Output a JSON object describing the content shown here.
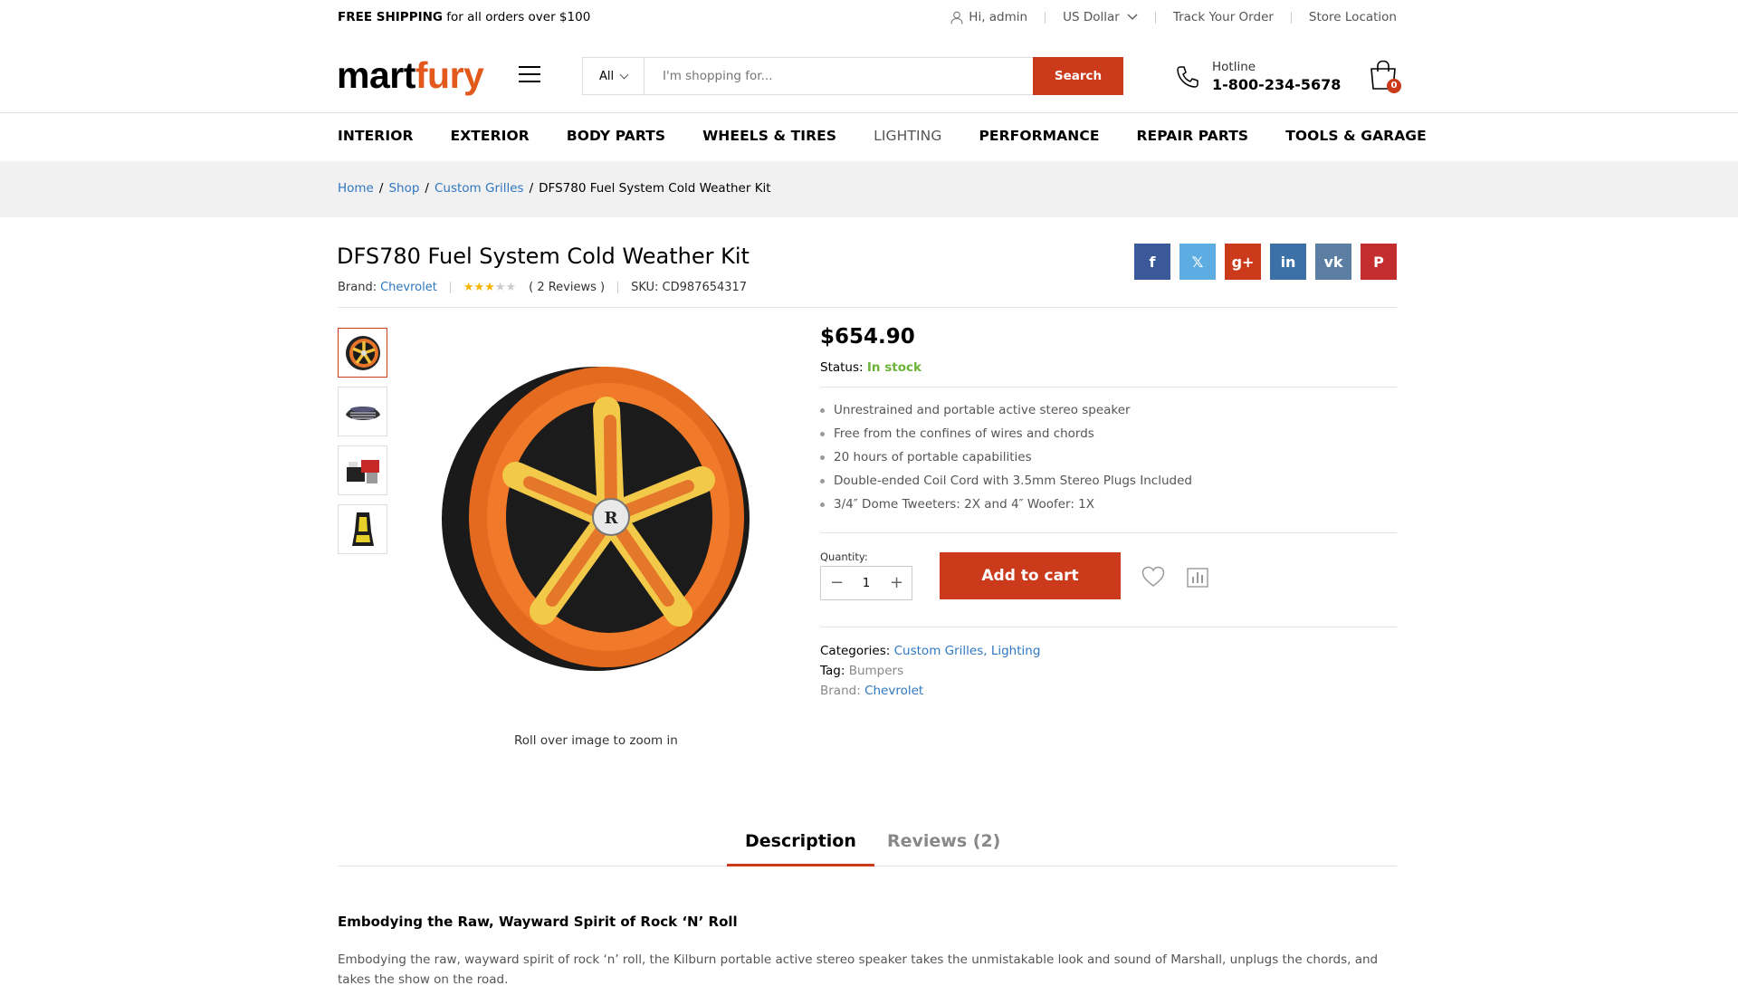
{
  "topbar": {
    "shipping_bold": "FREE SHIPPING",
    "shipping_rest": " for all orders over $100",
    "user_greeting": "Hi, admin",
    "currency": "US Dollar",
    "track_order": "Track Your Order",
    "store_location": "Store Location"
  },
  "header": {
    "logo_part1": "mart",
    "logo_part2": "fury",
    "search_category": "All",
    "search_placeholder": "I'm shopping for...",
    "search_button": "Search",
    "hotline_label": "Hotline",
    "hotline_number": "1-800-234-5678",
    "cart_count": "0"
  },
  "menu": {
    "items": [
      "INTERIOR",
      "EXTERIOR",
      "BODY PARTS",
      "WHEELS & TIRES",
      "LIGHTING",
      "PERFORMANCE",
      "REPAIR PARTS",
      "TOOLS & GARAGE"
    ]
  },
  "breadcrumb": {
    "home": "Home",
    "shop": "Shop",
    "category": "Custom Grilles",
    "current": "DFS780 Fuel System Cold Weather Kit",
    "sep": "/"
  },
  "product": {
    "title": "DFS780 Fuel System Cold Weather Kit",
    "brand_label": "Brand:",
    "brand": "Chevrolet",
    "rating": 3,
    "rating_max": 5,
    "reviews": "( 2 Reviews )",
    "sku": "SKU: CD987654317",
    "price": "$654.90",
    "status_label": "Status:",
    "status": "In stock",
    "features": [
      "Unrestrained and portable active stereo speaker",
      "Free from the confines of wires and chords",
      "20 hours of portable capabilities",
      "Double-ended Coil Cord with 3.5mm Stereo Plugs Included",
      "3/4″ Dome Tweeters: 2X and 4″ Woofer: 1X"
    ],
    "quantity_label": "Quantity:",
    "quantity": "1",
    "add_to_cart": "Add to cart",
    "categories_label": "Categories:",
    "categories": "Custom Grilles, Lighting",
    "tag_label": "Tag:",
    "tag": "Bumpers",
    "brand_label2": "Brand:",
    "brand2": "Chevrolet",
    "zoom_hint": "Roll over image to zoom in"
  },
  "social": [
    {
      "icon": "facebook-icon",
      "glyph": "f",
      "color": "#3b5999"
    },
    {
      "icon": "twitter-icon",
      "glyph": "𝕏",
      "color": "#5dade2"
    },
    {
      "icon": "google-plus-icon",
      "glyph": "g+",
      "color": "#cc3a1c"
    },
    {
      "icon": "linkedin-icon",
      "glyph": "in",
      "color": "#3c71a8"
    },
    {
      "icon": "vk-icon",
      "glyph": "vk",
      "color": "#5d7ea3"
    },
    {
      "icon": "pinterest-icon",
      "glyph": "P",
      "color": "#c42d2d"
    }
  ],
  "tabs": {
    "description": "Description",
    "reviews": "Reviews (2)"
  },
  "description": {
    "heading": "Embodying the Raw, Wayward Spirit of Rock ‘N’ Roll",
    "text": "Embodying the raw, wayward spirit of rock ‘n’ roll, the Kilburn portable active stereo speaker takes the unmistakable look and sound of Marshall, unplugs the chords, and takes the show on the road."
  },
  "colors": {
    "accent": "#cc3a1c",
    "link": "#2f77c1",
    "in_stock": "#6bb339",
    "logo_orange": "#e2591b",
    "star": "#f4b400"
  }
}
